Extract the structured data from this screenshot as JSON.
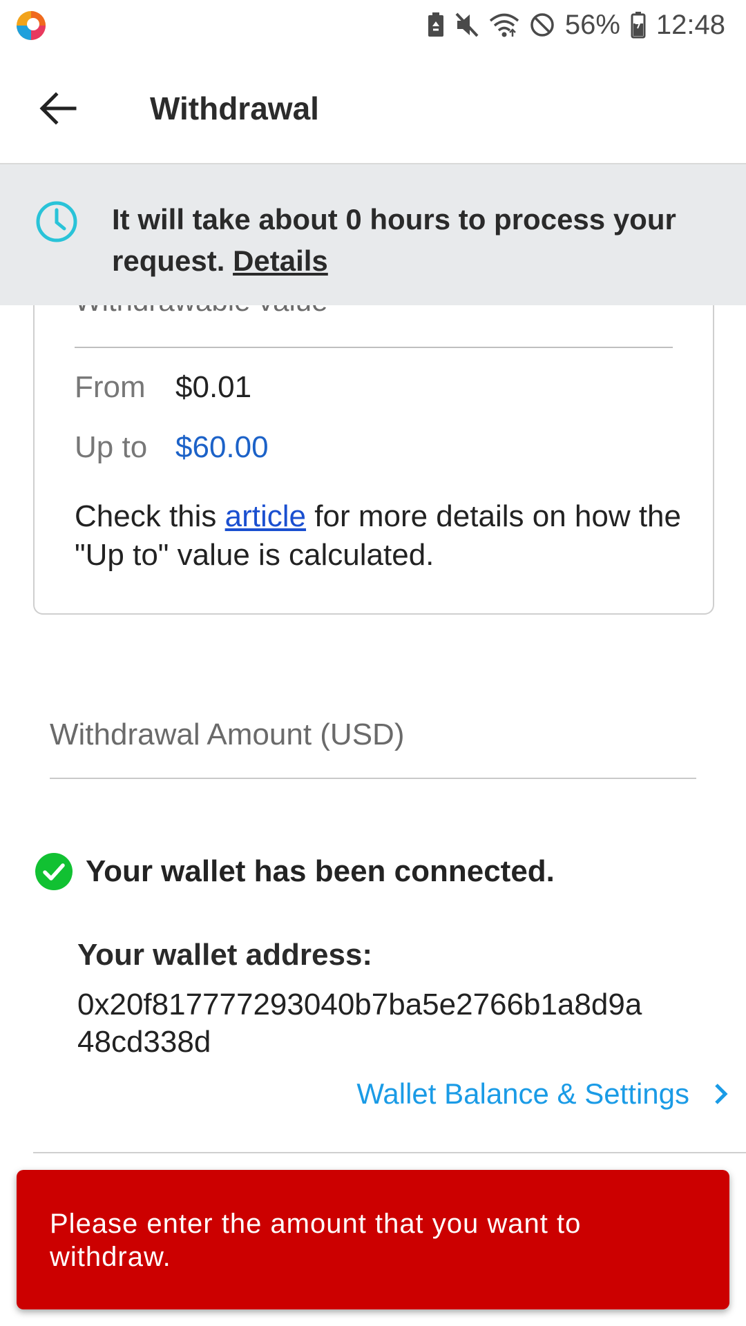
{
  "status_bar": {
    "battery_percent": "56%",
    "time": "12:48",
    "icons": [
      "battery-saver-icon",
      "mute-icon",
      "wifi-icon",
      "do-not-disturb-icon",
      "battery-icon"
    ]
  },
  "app_bar": {
    "title": "Withdrawal",
    "back_icon": "arrow-left-icon"
  },
  "notice": {
    "icon": "clock-icon",
    "text": "It will take about 0 hours to process your request.",
    "link_label": "Details"
  },
  "withdrawable_card": {
    "heading": "Withdrawable value",
    "from_label": "From",
    "from_value": "$0.01",
    "up_to_label": "Up to",
    "up_to_value": "$60.00",
    "note_prefix": "Check this",
    "note_link": "article",
    "note_suffix": "for more details on how the \"Up to\" value is calculated."
  },
  "amount_input": {
    "placeholder": "Withdrawal Amount (USD)",
    "value": ""
  },
  "wallet": {
    "status_icon": "check-circle-icon",
    "status_text": "Your wallet has been connected.",
    "address_label": "Your wallet address:",
    "address_value": "0x20f817777293040b7ba5e2766b1a8d9a48cd338d",
    "settings_link": "Wallet Balance & Settings"
  },
  "toast": {
    "message": "Please enter the amount that you want to withdraw."
  },
  "colors": {
    "accent_blue": "#1c62c8",
    "link_blue": "#1a9be6",
    "success_green": "#11c132",
    "error_red": "#cc0000",
    "notice_bg": "#e8eaec",
    "clock_cyan": "#29c3d8"
  }
}
